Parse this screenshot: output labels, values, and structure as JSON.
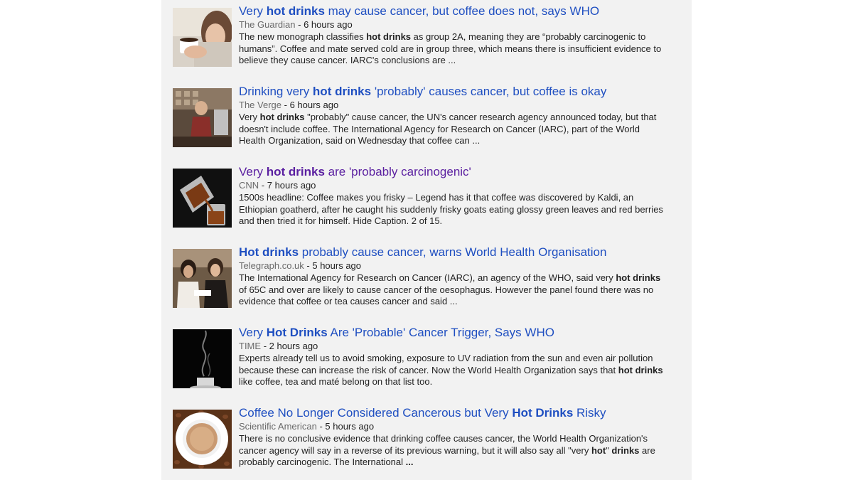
{
  "results": [
    {
      "title": [
        [
          "Very ",
          false
        ],
        [
          "hot drinks",
          true
        ],
        [
          " may cause cancer, but coffee does not, says WHO",
          false
        ]
      ],
      "source": "The Guardian",
      "time": "- 6 hours ago",
      "snippet": [
        [
          "The new monograph classifies ",
          false
        ],
        [
          "hot drinks",
          true
        ],
        [
          " as group 2A, meaning they are “probably carcinogenic to humans”. Coffee and mate served cold are in group three, which means there is insufficient evidence to believe they cause cancer. IARC's conclusions are ...",
          false
        ]
      ],
      "visited": false,
      "image": "woman-holding-coffee-cup"
    },
    {
      "title": [
        [
          "Drinking very ",
          false
        ],
        [
          "hot drinks",
          true
        ],
        [
          " 'probably' causes cancer, but coffee is okay",
          false
        ]
      ],
      "source": "The Verge",
      "time": "- 6 hours ago",
      "snippet": [
        [
          "Very ",
          false
        ],
        [
          "hot drinks",
          true
        ],
        [
          " \"probably\" cause cancer, the UN's cancer research agency announced today, but that doesn't include coffee. The International Agency for Research on Cancer (IARC), part of the World Health Organization, said on Wednesday that coffee can ...",
          false
        ]
      ],
      "visited": false,
      "image": "barista-at-coffee-shop"
    },
    {
      "title": [
        [
          "Very ",
          false
        ],
        [
          "hot drinks",
          true
        ],
        [
          " are 'probably carcinogenic'",
          false
        ]
      ],
      "source": "CNN",
      "time": "- 7 hours ago",
      "snippet": [
        [
          "1500s headline: Coffee makes you frisky – Legend has it that coffee was discovered by Kaldi, an Ethiopian goatherd, after he caught his suddenly frisky goats eating glossy green leaves and red berries and then tried it for himself. Hide Caption. 2 of 15.",
          false
        ]
      ],
      "visited": true,
      "image": "pouring-coffee-pot"
    },
    {
      "title": [
        [
          "Hot drinks",
          true
        ],
        [
          " probably cause cancer, warns World Health Organisation",
          false
        ]
      ],
      "source": "Telegraph.co.uk",
      "time": "- 5 hours ago",
      "snippet": [
        [
          "The International Agency for Research on Cancer (IARC), an agency of the WHO, said very ",
          false
        ],
        [
          "hot drinks",
          true
        ],
        [
          " of 65C and over are likely to cause cancer of the oesophagus. However the panel found there was no evidence that coffee or tea causes cancer and said ...",
          false
        ]
      ],
      "visited": false,
      "image": "women-drinking-tea"
    },
    {
      "title": [
        [
          "Very ",
          false
        ],
        [
          "Hot Drinks",
          true
        ],
        [
          " Are 'Probable' Cancer Trigger, Says WHO",
          false
        ]
      ],
      "source": "TIME",
      "time": "- 2 hours ago",
      "snippet": [
        [
          "Experts already tell us to avoid smoking, exposure to UV radiation from the sun and even air pollution because these can increase the risk of cancer. Now the World Health Organization says that ",
          false
        ],
        [
          "hot drinks",
          true
        ],
        [
          " like coffee, tea and maté belong on that list too.",
          false
        ]
      ],
      "visited": false,
      "image": "steaming-cup-dark"
    },
    {
      "title": [
        [
          "Coffee No Longer Considered Cancerous but Very ",
          false
        ],
        [
          "Hot Drinks",
          true
        ],
        [
          " Risky",
          false
        ]
      ],
      "source": "Scientific American",
      "time": "- 5 hours ago",
      "snippet": [
        [
          "There is no conclusive evidence that drinking coffee causes cancer, the World Health Organization's cancer agency will say in a reverse of its previous warning, but it will also say all \"very ",
          false
        ],
        [
          "hot",
          true
        ],
        [
          "\" ",
          false
        ],
        [
          "drinks",
          true
        ],
        [
          " are probably carcinogenic. The International ",
          false
        ],
        [
          "...",
          true
        ]
      ],
      "visited": false,
      "image": "coffee-cup-on-beans"
    }
  ]
}
